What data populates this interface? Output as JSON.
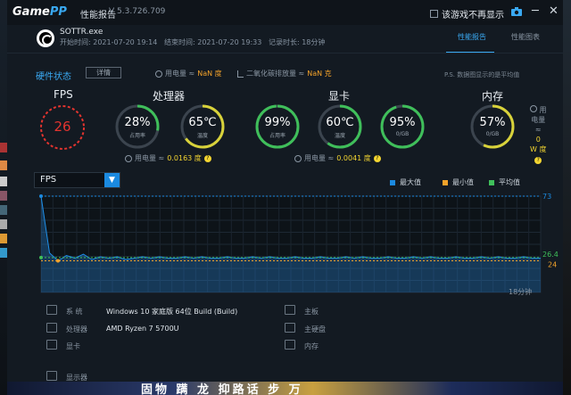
{
  "titlebar": {
    "logo_main": "Game",
    "logo_accent": "PP",
    "title": "性能报告",
    "version": "V 5.3.726.709",
    "no_show_label": "该游戏不再显示",
    "minimize": "─",
    "close": "✕"
  },
  "session": {
    "app_name": "SOTTR.exe",
    "start_label": "开始时间:",
    "start_time": "2021-07-20 19:14",
    "end_label": "结束时间:",
    "end_time": "2021-07-20 19:33",
    "duration_label": "记录时长:",
    "duration": "18分钟"
  },
  "tabs": [
    {
      "label": "性能报告",
      "active": true
    },
    {
      "label": "性能图表",
      "active": false
    }
  ],
  "hardware_status": {
    "title": "硬件状态",
    "detail_button": "详情",
    "power_label": "用电量 ≈",
    "power_value": "NaN 度",
    "co2_label": "二氧化碳排放量 ≈",
    "co2_value": "NaN 克",
    "note": "P.S. 数据图显示的是平均值"
  },
  "sections": {
    "fps": "FPS",
    "cpu": "处理器",
    "gpu": "显卡",
    "mem": "内存"
  },
  "gauges": {
    "fps": {
      "value": "26"
    },
    "cpu_usage": {
      "value": "28%",
      "label": "占用率",
      "fraction": 0.28
    },
    "cpu_temp": {
      "value": "65℃",
      "label": "温度",
      "fraction": 0.65
    },
    "gpu_usage": {
      "value": "99%",
      "label": "占用率",
      "fraction": 0.99
    },
    "gpu_temp": {
      "value": "60℃",
      "label": "温度",
      "fraction": 0.6
    },
    "gpu_mem": {
      "value": "95%",
      "label": "0/GB",
      "fraction": 0.95
    },
    "mem_usage": {
      "value": "57%",
      "label": "0/GB",
      "fraction": 0.57
    }
  },
  "power": {
    "cpu_label": "用电量 ≈",
    "cpu_value": "0.0163 度",
    "gpu_label": "用电量 ≈",
    "gpu_value": "0.0041 度",
    "mem_label_1": "用",
    "mem_label_2": "电量",
    "mem_label_3": "≈",
    "mem_label_4": "0",
    "mem_value": "W 度"
  },
  "chart": {
    "selector_label": "FPS",
    "legend": [
      {
        "label": "最大值",
        "color": "#1b8ae0"
      },
      {
        "label": "最小值",
        "color": "#f3a22a"
      },
      {
        "label": "平均值",
        "color": "#3fbf5a"
      }
    ],
    "max_label": "73",
    "avg_label": "26.44",
    "min_label": "24",
    "duration_label": "18分钟"
  },
  "chart_data": {
    "type": "area",
    "title": "",
    "xlabel": "",
    "ylabel": "FPS",
    "ylim": [
      0,
      73
    ],
    "x_range_minutes": [
      0,
      18
    ],
    "max": 73,
    "min": 24,
    "avg": 26.44,
    "series": [
      {
        "values": [
          73,
          30,
          24,
          28,
          26,
          29,
          25,
          27,
          26,
          27,
          25,
          26,
          27,
          26,
          27,
          26,
          26,
          27,
          26,
          27,
          26,
          26,
          27,
          26,
          26,
          27,
          26,
          27,
          26,
          26,
          27,
          26,
          26,
          27,
          26,
          26,
          27,
          26,
          27,
          26,
          26,
          27,
          26,
          26,
          27,
          26,
          27,
          26,
          26,
          27,
          26,
          26,
          27,
          26,
          27,
          26,
          26,
          27,
          26,
          26
        ]
      }
    ]
  },
  "specs": {
    "system_label": "系 统",
    "system_value": "Windows 10 家庭版 64位   Build (Build)",
    "cpu_label": "处理器",
    "cpu_value": "AMD Ryzen 7 5700U",
    "gpu_label": "显卡",
    "monitor_label": "显示器",
    "board_label": "主板",
    "disk_label": "主硬盘",
    "ram_label": "内存"
  },
  "ad": {
    "text": "固物 蹒 龙 抑路话 步 万"
  },
  "colors": {
    "accent": "#3aa9f2",
    "fps_red": "#e3342f",
    "gauge_green": "#3fbf5a",
    "gauge_yellow": "#d8d23a",
    "power_yellow": "#f3d531"
  }
}
